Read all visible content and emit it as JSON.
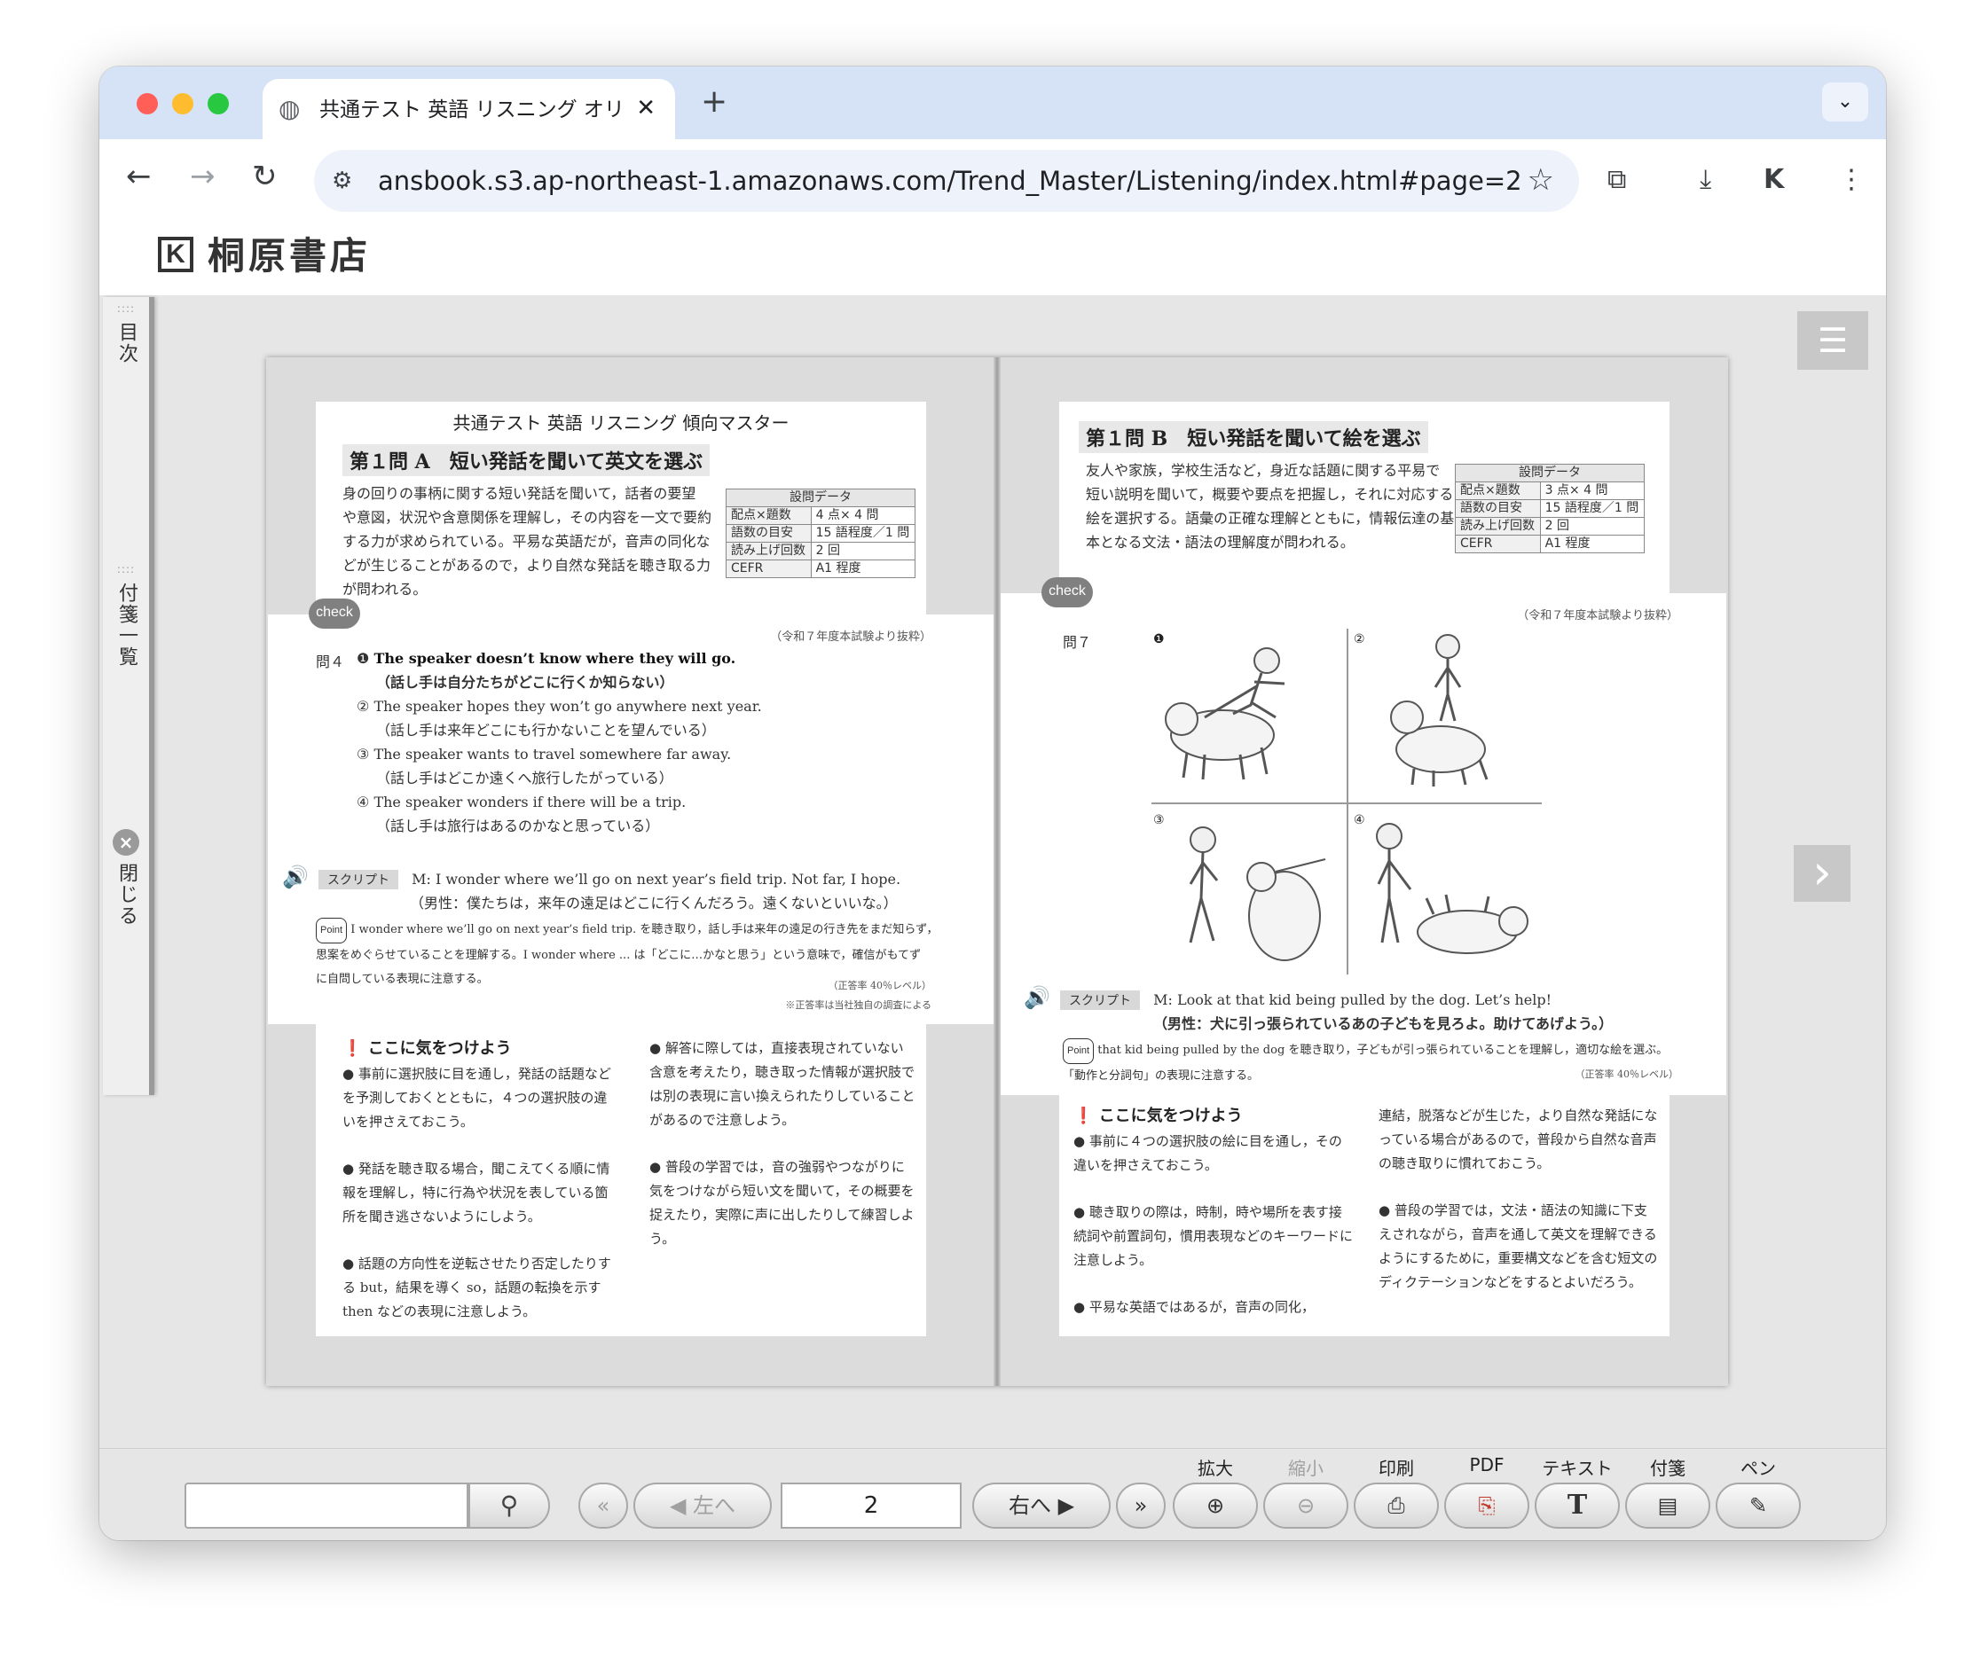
{
  "browser": {
    "tab_title": "共通テスト 英語 リスニング オリ",
    "tab_close": "✕",
    "new_tab": "+",
    "url": "ansbook.s3.ap-northeast-1.amazonaws.com/Trend_Master/Listening/index.html#page=2",
    "traffic_colors": [
      "#ff5f57",
      "#febc2e",
      "#28c840"
    ]
  },
  "site": {
    "logo_mark": "K",
    "logo_text": "桐原書店"
  },
  "sidebar": {
    "toc": "目次",
    "sticky_list": "付箋一覧",
    "close": "閉じる"
  },
  "left_page": {
    "book_title": "共通テスト 英語 リスニング 傾向マスター",
    "section_title": "第１問 A　短い発話を聞いて英文を選ぶ",
    "intro_lines": [
      "身の回りの事柄に関する短い発話を聞いて，話者の要望",
      "や意図，状況や含意関係を理解し，その内容を一文で要約",
      "する力が求められている。平易な英語だが，音声の同化な",
      "どが生じることがあるので，より自然な発話を聴き取る力",
      "が問われる。"
    ],
    "data_table": {
      "header": "設問データ",
      "rows": [
        [
          "配点×題数",
          "4 点× 4 問"
        ],
        [
          "語数の目安",
          "15 語程度／1 問"
        ],
        [
          "読み上げ回数",
          "2 回"
        ],
        [
          "CEFR",
          "A1 程度"
        ]
      ]
    },
    "check": "check",
    "source_note": "（令和７年度本試験より抜粋）",
    "question_label": "問４",
    "options": [
      {
        "num": "❶",
        "en": "The speaker doesn’t know where they will go.",
        "ja": "（話し手は自分たちがどこに行くか知らない）"
      },
      {
        "num": "②",
        "en": "The speaker hopes they won’t go anywhere next year.",
        "ja": "（話し手は来年どこにも行かないことを望んでいる）"
      },
      {
        "num": "③",
        "en": "The speaker wants to travel somewhere far away.",
        "ja": "（話し手はどこか遠くへ旅行したがっている）"
      },
      {
        "num": "④",
        "en": "The speaker wonders if there will be a trip.",
        "ja": "（話し手は旅行はあるのかなと思っている）"
      }
    ],
    "script_label": "スクリプト",
    "script_en": "M: I wonder where we’ll go on next year’s field trip. Not far, I hope.",
    "script_ja": "（男性：僕たちは，来年の遠足はどこに行くんだろう。遠くないといいな。）",
    "point_label": "Point",
    "point_line1": "I wonder where we’ll go on next year’s field trip. を聴き取り，話し手は来年の遠足の行き先をまだ知らず，",
    "point_line2": "思案をめぐらせていることを理解する。I wonder where ... は「どこに…かなと思う」という意味で，確信がもてず",
    "point_line3": "に自問している表現に注意する。",
    "rate": "（正答率 40％レベル）",
    "rate_note": "※正答率は当社独自の調査による",
    "tips_title": "ここに気をつけよう",
    "tips_col1": [
      "● 事前に選択肢に目を通し，発話の話題などを予測しておくとともに，４つの選択肢の違いを押さえておこう。",
      "● 発話を聴き取る場合，聞こえてくる順に情報を理解し，特に行為や状況を表している箇所を聞き逃さないようにしよう。",
      "● 話題の方向性を逆転させたり否定したりする but，結果を導く so，話題の転換を示す then などの表現に注意しよう。"
    ],
    "tips_col2": [
      "● 解答に際しては，直接表現されていない含意を考えたり，聴き取った情報が選択肢では別の表現に言い換えられたりしていることがあるので注意しよう。",
      "● 普段の学習では，音の強弱やつながりに気をつけながら短い文を聞いて，その概要を捉えたり，実際に声に出したりして練習しよう。"
    ]
  },
  "right_page": {
    "section_title": "第１問 B　短い発話を聞いて絵を選ぶ",
    "intro_lines": [
      "友人や家族，学校生活など，身近な話題に関する平易で",
      "短い説明を聞いて，概要や要点を把握し，それに対応する",
      "絵を選択する。語彙の正確な理解とともに，情報伝達の基",
      "本となる文法・語法の理解度が問われる。"
    ],
    "data_table": {
      "header": "設問データ",
      "rows": [
        [
          "配点×題数",
          "3 点× 4 問"
        ],
        [
          "語数の目安",
          "15 語程度／1 問"
        ],
        [
          "読み上げ回数",
          "2 回"
        ],
        [
          "CEFR",
          "A1 程度"
        ]
      ]
    },
    "check": "check",
    "source_note": "（令和７年度本試験より抜粋）",
    "question_label": "問７",
    "picture_numbers": [
      "❶",
      "②",
      "③",
      "④"
    ],
    "script_label": "スクリプト",
    "script_en": "M: Look at that kid being pulled by the dog. Let’s help!",
    "script_ja": "（男性：犬に引っ張られているあの子どもを見ろよ。助けてあげよう。）",
    "point_label": "Point",
    "point_line1": "that kid being pulled by the dog を聴き取り，子どもが引っ張られていることを理解し，適切な絵を選ぶ。",
    "point_line2": "「動作と分詞句」の表現に注意する。",
    "rate": "（正答率 40％レベル）",
    "tips_title": "ここに気をつけよう",
    "tips_col1": [
      "● 事前に４つの選択肢の絵に目を通し，その違いを押さえておこう。",
      "● 聴き取りの際は，時制，時や場所を表す接続詞や前置詞句，慣用表現などのキーワードに注意しよう。",
      "● 平易な英語ではあるが，音声の同化，"
    ],
    "tips_col2": [
      "連結，脱落などが生じた，より自然な発話になっている場合があるので，普段から自然な音声の聴き取りに慣れておこう。",
      "● 普段の学習では，文法・語法の知識に下支えされながら，音声を通して英文を理解できるようにするために，重要構文などを含む短文のディクテーションなどをするとよいだろう。"
    ]
  },
  "bottom": {
    "search_value": "",
    "prev_label": "左へ",
    "page_value": "2",
    "next_label": "右へ",
    "zoom_in": "拡大",
    "zoom_out": "縮小",
    "print": "印刷",
    "pdf": "PDF",
    "text": "テキスト",
    "sticky": "付箋",
    "pen": "ペン"
  }
}
